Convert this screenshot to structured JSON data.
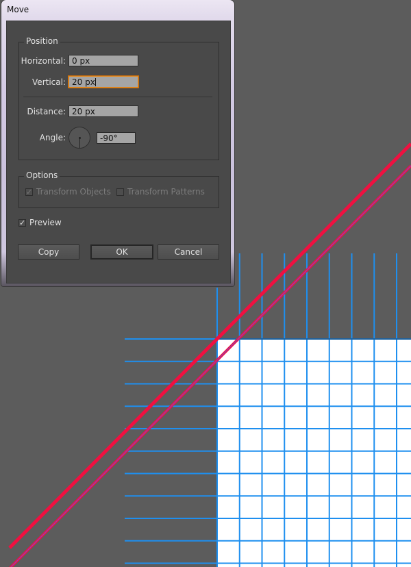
{
  "dialog": {
    "title": "Move",
    "position": {
      "legend": "Position",
      "horizontal_label": "Horizontal:",
      "horizontal_value": "0 px",
      "vertical_label": "Vertical:",
      "vertical_value": "20 px",
      "distance_label": "Distance:",
      "distance_value": "20 px",
      "angle_label": "Angle:",
      "angle_value": "-90°"
    },
    "options": {
      "legend": "Options",
      "transform_objects_label": "Transform Objects",
      "transform_objects_checked": true,
      "transform_objects_enabled": false,
      "transform_patterns_label": "Transform Patterns",
      "transform_patterns_checked": false,
      "transform_patterns_enabled": false
    },
    "preview_label": "Preview",
    "preview_checked": true,
    "buttons": {
      "copy": "Copy",
      "ok": "OK",
      "cancel": "Cancel"
    }
  },
  "canvas": {
    "colors": {
      "background": "#5c5c5c",
      "grid_line": "#1e8fef",
      "artboard": "#ffffff",
      "stroke": "#f01040",
      "selection": "#7a4cd0"
    },
    "check_glyph": "✓"
  }
}
